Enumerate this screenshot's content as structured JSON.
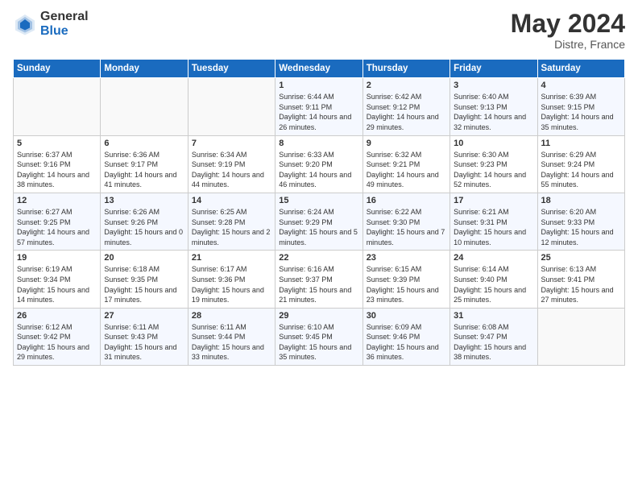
{
  "logo": {
    "general": "General",
    "blue": "Blue"
  },
  "title": "May 2024",
  "subtitle": "Distre, France",
  "headers": [
    "Sunday",
    "Monday",
    "Tuesday",
    "Wednesday",
    "Thursday",
    "Friday",
    "Saturday"
  ],
  "weeks": [
    [
      {
        "day": "",
        "info": ""
      },
      {
        "day": "",
        "info": ""
      },
      {
        "day": "",
        "info": ""
      },
      {
        "day": "1",
        "info": "Sunrise: 6:44 AM\nSunset: 9:11 PM\nDaylight: 14 hours and 26 minutes."
      },
      {
        "day": "2",
        "info": "Sunrise: 6:42 AM\nSunset: 9:12 PM\nDaylight: 14 hours and 29 minutes."
      },
      {
        "day": "3",
        "info": "Sunrise: 6:40 AM\nSunset: 9:13 PM\nDaylight: 14 hours and 32 minutes."
      },
      {
        "day": "4",
        "info": "Sunrise: 6:39 AM\nSunset: 9:15 PM\nDaylight: 14 hours and 35 minutes."
      }
    ],
    [
      {
        "day": "5",
        "info": "Sunrise: 6:37 AM\nSunset: 9:16 PM\nDaylight: 14 hours and 38 minutes."
      },
      {
        "day": "6",
        "info": "Sunrise: 6:36 AM\nSunset: 9:17 PM\nDaylight: 14 hours and 41 minutes."
      },
      {
        "day": "7",
        "info": "Sunrise: 6:34 AM\nSunset: 9:19 PM\nDaylight: 14 hours and 44 minutes."
      },
      {
        "day": "8",
        "info": "Sunrise: 6:33 AM\nSunset: 9:20 PM\nDaylight: 14 hours and 46 minutes."
      },
      {
        "day": "9",
        "info": "Sunrise: 6:32 AM\nSunset: 9:21 PM\nDaylight: 14 hours and 49 minutes."
      },
      {
        "day": "10",
        "info": "Sunrise: 6:30 AM\nSunset: 9:23 PM\nDaylight: 14 hours and 52 minutes."
      },
      {
        "day": "11",
        "info": "Sunrise: 6:29 AM\nSunset: 9:24 PM\nDaylight: 14 hours and 55 minutes."
      }
    ],
    [
      {
        "day": "12",
        "info": "Sunrise: 6:27 AM\nSunset: 9:25 PM\nDaylight: 14 hours and 57 minutes."
      },
      {
        "day": "13",
        "info": "Sunrise: 6:26 AM\nSunset: 9:26 PM\nDaylight: 15 hours and 0 minutes."
      },
      {
        "day": "14",
        "info": "Sunrise: 6:25 AM\nSunset: 9:28 PM\nDaylight: 15 hours and 2 minutes."
      },
      {
        "day": "15",
        "info": "Sunrise: 6:24 AM\nSunset: 9:29 PM\nDaylight: 15 hours and 5 minutes."
      },
      {
        "day": "16",
        "info": "Sunrise: 6:22 AM\nSunset: 9:30 PM\nDaylight: 15 hours and 7 minutes."
      },
      {
        "day": "17",
        "info": "Sunrise: 6:21 AM\nSunset: 9:31 PM\nDaylight: 15 hours and 10 minutes."
      },
      {
        "day": "18",
        "info": "Sunrise: 6:20 AM\nSunset: 9:33 PM\nDaylight: 15 hours and 12 minutes."
      }
    ],
    [
      {
        "day": "19",
        "info": "Sunrise: 6:19 AM\nSunset: 9:34 PM\nDaylight: 15 hours and 14 minutes."
      },
      {
        "day": "20",
        "info": "Sunrise: 6:18 AM\nSunset: 9:35 PM\nDaylight: 15 hours and 17 minutes."
      },
      {
        "day": "21",
        "info": "Sunrise: 6:17 AM\nSunset: 9:36 PM\nDaylight: 15 hours and 19 minutes."
      },
      {
        "day": "22",
        "info": "Sunrise: 6:16 AM\nSunset: 9:37 PM\nDaylight: 15 hours and 21 minutes."
      },
      {
        "day": "23",
        "info": "Sunrise: 6:15 AM\nSunset: 9:39 PM\nDaylight: 15 hours and 23 minutes."
      },
      {
        "day": "24",
        "info": "Sunrise: 6:14 AM\nSunset: 9:40 PM\nDaylight: 15 hours and 25 minutes."
      },
      {
        "day": "25",
        "info": "Sunrise: 6:13 AM\nSunset: 9:41 PM\nDaylight: 15 hours and 27 minutes."
      }
    ],
    [
      {
        "day": "26",
        "info": "Sunrise: 6:12 AM\nSunset: 9:42 PM\nDaylight: 15 hours and 29 minutes."
      },
      {
        "day": "27",
        "info": "Sunrise: 6:11 AM\nSunset: 9:43 PM\nDaylight: 15 hours and 31 minutes."
      },
      {
        "day": "28",
        "info": "Sunrise: 6:11 AM\nSunset: 9:44 PM\nDaylight: 15 hours and 33 minutes."
      },
      {
        "day": "29",
        "info": "Sunrise: 6:10 AM\nSunset: 9:45 PM\nDaylight: 15 hours and 35 minutes."
      },
      {
        "day": "30",
        "info": "Sunrise: 6:09 AM\nSunset: 9:46 PM\nDaylight: 15 hours and 36 minutes."
      },
      {
        "day": "31",
        "info": "Sunrise: 6:08 AM\nSunset: 9:47 PM\nDaylight: 15 hours and 38 minutes."
      },
      {
        "day": "",
        "info": ""
      }
    ]
  ]
}
